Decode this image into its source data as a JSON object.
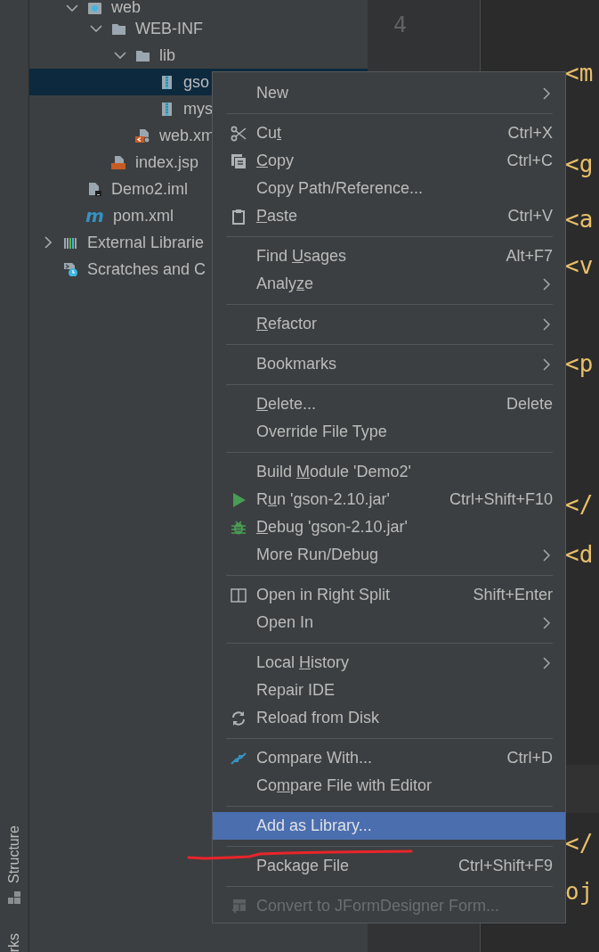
{
  "tool_strip": [
    {
      "label": "Structure",
      "kind": "full"
    },
    {
      "label": "rks",
      "kind": "cut"
    }
  ],
  "project_tree": {
    "items": [
      {
        "label": "web",
        "kind": "web-folder",
        "expanded": true,
        "selected": false,
        "children": [
          {
            "label": "WEB-INF",
            "kind": "folder",
            "expanded": true,
            "selected": false,
            "children": [
              {
                "label": "lib",
                "kind": "folder",
                "expanded": true,
                "selected": false,
                "children": [
                  {
                    "label": "gso",
                    "kind": "jar",
                    "selected": true
                  },
                  {
                    "label": "mys",
                    "kind": "jar",
                    "selected": false
                  }
                ]
              },
              {
                "label": "web.xm",
                "kind": "web-xml",
                "selected": false
              }
            ]
          },
          {
            "label": "index.jsp",
            "kind": "jsp",
            "selected": false
          }
        ]
      },
      {
        "label": "Demo2.iml",
        "kind": "iml",
        "selected": false
      },
      {
        "label": "pom.xml",
        "kind": "maven",
        "icon_glyph": "m",
        "selected": false
      }
    ],
    "outer_items": [
      {
        "label": "External Librarie",
        "kind": "libraries",
        "expanded": false,
        "selected": false
      },
      {
        "label": "Scratches and C",
        "kind": "scratches",
        "selected": false
      }
    ]
  },
  "gutter": {
    "line_numbers": [
      "4"
    ]
  },
  "editor": {
    "code_lines": [
      "<m",
      "<g",
      "<a",
      "<v",
      "<p",
      "</",
      "<d",
      "</",
      "oj"
    ]
  },
  "context_menu": {
    "items": [
      {
        "kind": "item",
        "label": "New",
        "submenu": true,
        "selected": false,
        "disabled": false
      },
      {
        "kind": "separator"
      },
      {
        "kind": "item",
        "mnemonic_label": {
          "before": "Cu",
          "key": "t"
        },
        "shortcut": "Ctrl+X",
        "submenu": false,
        "selected": false,
        "disabled": false
      },
      {
        "kind": "item",
        "mnemonic_label": {
          "key": "C",
          "after": "opy"
        },
        "shortcut": "Ctrl+C",
        "submenu": false,
        "selected": false,
        "disabled": false
      },
      {
        "kind": "item",
        "label": "Copy Path/Reference...",
        "submenu": false,
        "selected": false,
        "disabled": false
      },
      {
        "kind": "item",
        "mnemonic_label": {
          "key": "P",
          "after": "aste"
        },
        "shortcut": "Ctrl+V",
        "submenu": false,
        "selected": false,
        "disabled": false
      },
      {
        "kind": "separator"
      },
      {
        "kind": "item",
        "mnemonic_label": {
          "before": "Find ",
          "key": "U",
          "after": "sages"
        },
        "shortcut": "Alt+F7",
        "submenu": false,
        "selected": false,
        "disabled": false
      },
      {
        "kind": "item",
        "mnemonic_label": {
          "before": "Analy",
          "key": "z",
          "after": "e"
        },
        "submenu": true,
        "selected": false,
        "disabled": false
      },
      {
        "kind": "separator"
      },
      {
        "kind": "item",
        "mnemonic_label": {
          "key": "R",
          "after": "efactor"
        },
        "submenu": true,
        "selected": false,
        "disabled": false
      },
      {
        "kind": "separator"
      },
      {
        "kind": "item",
        "label": "Bookmarks",
        "submenu": true,
        "selected": false,
        "disabled": false
      },
      {
        "kind": "separator"
      },
      {
        "kind": "item",
        "mnemonic_label": {
          "key": "D",
          "after": "elete..."
        },
        "shortcut": "Delete",
        "submenu": false,
        "selected": false,
        "disabled": false
      },
      {
        "kind": "item",
        "label": "Override File Type",
        "submenu": false,
        "selected": false,
        "disabled": false
      },
      {
        "kind": "separator"
      },
      {
        "kind": "item",
        "mnemonic_label": {
          "before": "Build ",
          "key": "M",
          "after": "odule 'Demo2'"
        },
        "submenu": false,
        "selected": false,
        "disabled": false
      },
      {
        "kind": "item",
        "mnemonic_label": {
          "before": "R",
          "key": "u",
          "after": "n 'gson-2.10.jar'"
        },
        "shortcut": "Ctrl+Shift+F10",
        "submenu": false,
        "selected": false,
        "disabled": false
      },
      {
        "kind": "item",
        "mnemonic_label": {
          "key": "D",
          "after": "ebug 'gson-2.10.jar'"
        },
        "submenu": false,
        "selected": false,
        "disabled": false
      },
      {
        "kind": "item",
        "label": "More Run/Debug",
        "submenu": true,
        "selected": false,
        "disabled": false
      },
      {
        "kind": "separator"
      },
      {
        "kind": "item",
        "label": "Open in Right Split",
        "shortcut": "Shift+Enter",
        "submenu": false,
        "selected": false,
        "disabled": false
      },
      {
        "kind": "item",
        "label": "Open In",
        "submenu": true,
        "selected": false,
        "disabled": false
      },
      {
        "kind": "separator"
      },
      {
        "kind": "item",
        "mnemonic_label": {
          "before": "Local ",
          "key": "H",
          "after": "istory"
        },
        "submenu": true,
        "selected": false,
        "disabled": false
      },
      {
        "kind": "item",
        "label": "Repair IDE",
        "submenu": false,
        "selected": false,
        "disabled": false
      },
      {
        "kind": "item",
        "label": "Reload from Disk",
        "submenu": false,
        "selected": false,
        "disabled": false
      },
      {
        "kind": "separator"
      },
      {
        "kind": "item",
        "label": "Compare With...",
        "shortcut": "Ctrl+D",
        "submenu": false,
        "selected": false,
        "disabled": false
      },
      {
        "kind": "item",
        "mnemonic_label": {
          "before": "Co",
          "key": "m",
          "after": "pare File with Editor"
        },
        "submenu": false,
        "selected": false,
        "disabled": false
      },
      {
        "kind": "separator"
      },
      {
        "kind": "item",
        "label": "Add as Library...",
        "submenu": false,
        "selected": true,
        "disabled": false
      },
      {
        "kind": "separator"
      },
      {
        "kind": "item",
        "label": "Package File",
        "shortcut": "Ctrl+Shift+F9",
        "submenu": false,
        "selected": false,
        "disabled": false
      },
      {
        "kind": "separator"
      },
      {
        "kind": "item",
        "label": "Convert to JFormDesigner Form...",
        "submenu": false,
        "selected": false,
        "disabled": true
      }
    ]
  }
}
